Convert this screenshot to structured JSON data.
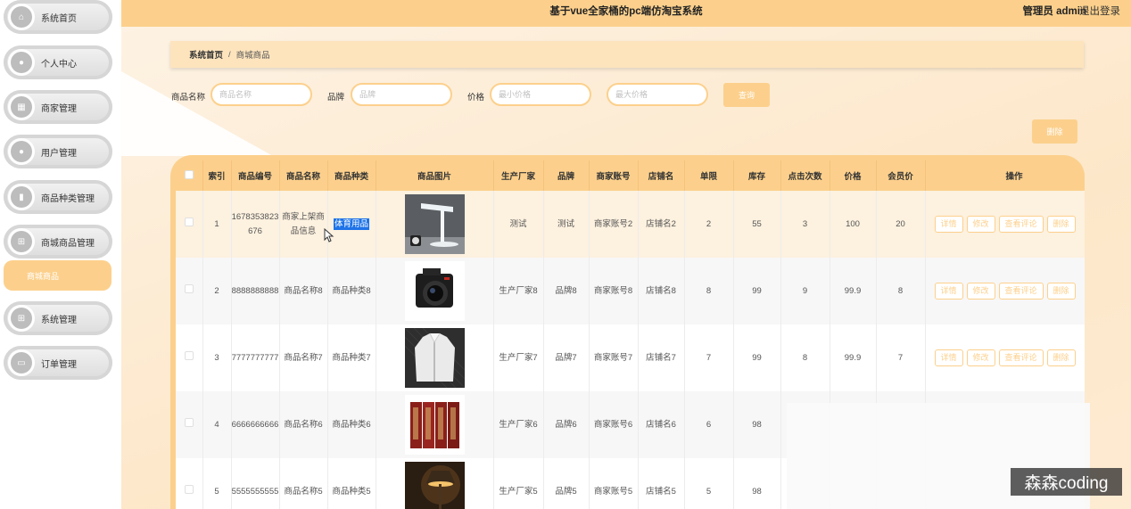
{
  "header": {
    "title": "基于vue全家桶的pc端仿淘宝系统",
    "user": "管理员 admin",
    "logout": "退出登录"
  },
  "sidebar": {
    "items": [
      {
        "label": "系统首页",
        "icon": "home-icon"
      },
      {
        "label": "个人中心",
        "icon": "user-icon"
      },
      {
        "label": "商家管理",
        "icon": "grid-icon"
      },
      {
        "label": "用户管理",
        "icon": "user-icon"
      },
      {
        "label": "商品种类管理",
        "icon": "book-icon"
      },
      {
        "label": "商城商品管理",
        "icon": "apps-icon"
      },
      {
        "label": "系统管理",
        "icon": "apps-icon"
      },
      {
        "label": "订单管理",
        "icon": "briefcase-icon"
      }
    ],
    "active_sub": "商城商品"
  },
  "breadcrumb": {
    "home": "系统首页",
    "separator": "/",
    "current": "商城商品"
  },
  "search": {
    "name_label": "商品名称",
    "name_placeholder": "商品名称",
    "brand_label": "品牌",
    "brand_placeholder": "品牌",
    "price_label": "价格",
    "min_placeholder": "最小价格",
    "max_placeholder": "最大价格",
    "query_button": "查询"
  },
  "delete_button": "删除",
  "table": {
    "headers": [
      "",
      "索引",
      "商品编号",
      "商品名称",
      "商品种类",
      "商品图片",
      "生产厂家",
      "品牌",
      "商家账号",
      "店铺名",
      "单限",
      "库存",
      "点击次数",
      "价格",
      "会员价",
      "操作"
    ],
    "ops": [
      "详情",
      "修改",
      "查看评论",
      "删除"
    ],
    "rows": [
      {
        "index": "1",
        "code": "1678353823676",
        "name": "商家上架商品信息",
        "category": "体育用品",
        "image": "lamp",
        "maker": "测试",
        "brand": "测试",
        "account": "商家账号2",
        "shop": "店铺名2",
        "limit": "2",
        "stock": "55",
        "clicks": "3",
        "price": "100",
        "vip": "20"
      },
      {
        "index": "2",
        "code": "8888888888",
        "name": "商品名称8",
        "category": "商品种类8",
        "image": "camera",
        "maker": "生产厂家8",
        "brand": "品牌8",
        "account": "商家账号8",
        "shop": "店铺名8",
        "limit": "8",
        "stock": "99",
        "clicks": "9",
        "price": "99.9",
        "vip": "8"
      },
      {
        "index": "3",
        "code": "7777777777",
        "name": "商品名称7",
        "category": "商品种类7",
        "image": "jacket",
        "maker": "生产厂家7",
        "brand": "品牌7",
        "account": "商家账号7",
        "shop": "店铺名7",
        "limit": "7",
        "stock": "99",
        "clicks": "8",
        "price": "99.9",
        "vip": "7"
      },
      {
        "index": "4",
        "code": "6666666666",
        "name": "商品名称6",
        "category": "商品种类6",
        "image": "books",
        "maker": "生产厂家6",
        "brand": "品牌6",
        "account": "商家账号6",
        "shop": "店铺名6",
        "limit": "6",
        "stock": "98",
        "clicks": "",
        "price": "",
        "vip": ""
      },
      {
        "index": "5",
        "code": "5555555555",
        "name": "商品名称5",
        "category": "商品种类5",
        "image": "desk-lamp",
        "maker": "生产厂家5",
        "brand": "品牌5",
        "account": "商家账号5",
        "shop": "店铺名5",
        "limit": "5",
        "stock": "98",
        "clicks": "",
        "price": "",
        "vip": ""
      }
    ]
  },
  "watermark": "森森coding"
}
